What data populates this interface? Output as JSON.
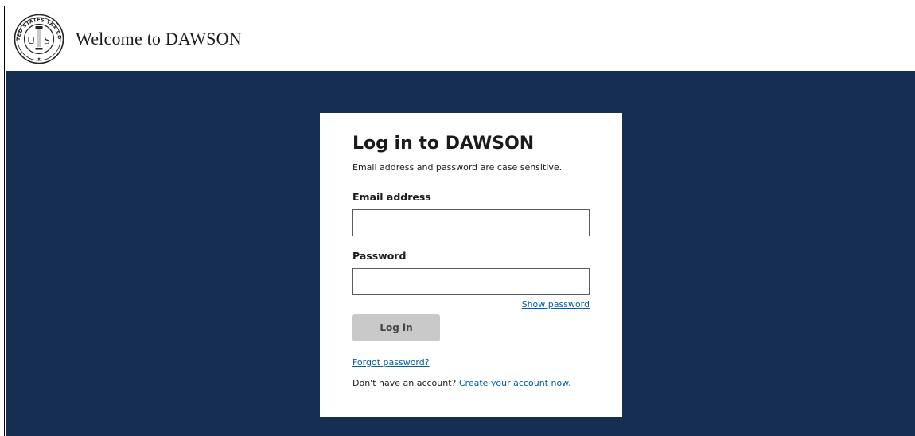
{
  "header": {
    "title": "Welcome to DAWSON",
    "seal": {
      "outer_text": "UNITED STATES TAX COURT",
      "center_text": "U S"
    }
  },
  "login": {
    "heading": "Log in to DAWSON",
    "hint": "Email address and password are case sensitive.",
    "email_label": "Email address",
    "email_value": "",
    "password_label": "Password",
    "password_value": "",
    "show_password": "Show password",
    "login_button": "Log in",
    "forgot_password": "Forgot password?",
    "signup_prompt": "Don't have an account?",
    "signup_link": "Create your account now."
  },
  "colors": {
    "background": "#162e51",
    "card": "#ffffff",
    "link": "#005ea2",
    "disabled_button": "#c9c9c9"
  }
}
